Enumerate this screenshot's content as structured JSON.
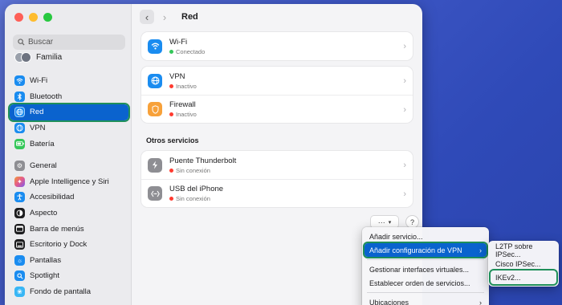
{
  "window": {
    "title": "Red"
  },
  "sidebar": {
    "search_placeholder": "Buscar",
    "family_label": "Familia",
    "items": [
      {
        "label": "Wi-Fi",
        "icon": "wifi-icon",
        "color": "#1a8cf0"
      },
      {
        "label": "Bluetooth",
        "icon": "bluetooth-icon",
        "color": "#1a8cf0"
      },
      {
        "label": "Red",
        "icon": "globe-icon",
        "color": "#1a8cf0",
        "selected": true
      },
      {
        "label": "VPN",
        "icon": "vpn-icon",
        "color": "#1a8cf0"
      },
      {
        "label": "Batería",
        "icon": "battery-icon",
        "color": "#34c759"
      },
      {
        "label": "General",
        "icon": "gear-icon",
        "color": "#8e8e93"
      },
      {
        "label": "Apple Intelligence y Siri",
        "icon": "siri-icon",
        "color": "#e35a8c"
      },
      {
        "label": "Accesibilidad",
        "icon": "accessibility-icon",
        "color": "#1a8cf0"
      },
      {
        "label": "Aspecto",
        "icon": "appearance-icon",
        "color": "#1d1d1f"
      },
      {
        "label": "Barra de menús",
        "icon": "menubar-icon",
        "color": "#1d1d1f"
      },
      {
        "label": "Escritorio y Dock",
        "icon": "dock-icon",
        "color": "#1d1d1f"
      },
      {
        "label": "Pantallas",
        "icon": "display-icon",
        "color": "#1a8cf0"
      },
      {
        "label": "Spotlight",
        "icon": "spotlight-icon",
        "color": "#1a8cf0"
      },
      {
        "label": "Fondo de pantalla",
        "icon": "wallpaper-icon",
        "color": "#38b6f5"
      }
    ]
  },
  "main": {
    "services": [
      {
        "title": "Wi-Fi",
        "status": "Conectado",
        "status_color": "#34c759",
        "icon": "wifi-icon",
        "icon_bg": "#1a8cf0"
      },
      {
        "title": "VPN",
        "status": "Inactivo",
        "status_color": "#ff3b30",
        "icon": "vpn-icon",
        "icon_bg": "#1a8cf0"
      },
      {
        "title": "Firewall",
        "status": "Inactivo",
        "status_color": "#ff3b30",
        "icon": "shield-icon",
        "icon_bg": "#f7a13a"
      }
    ],
    "other_title": "Otros servicios",
    "other_services": [
      {
        "title": "Puente Thunderbolt",
        "status": "Sin conexión",
        "status_color": "#ff3b30",
        "icon": "thunderbolt-icon",
        "icon_bg": "#8e8e93"
      },
      {
        "title": "USB del iPhone",
        "status": "Sin conexión",
        "status_color": "#ff3b30",
        "icon": "usb-icon",
        "icon_bg": "#8e8e93"
      }
    ],
    "action_button": "···",
    "help_button": "?"
  },
  "menu": {
    "items": [
      {
        "label": "Añadir servicio..."
      },
      {
        "label": "Añadir configuración de VPN",
        "active": true,
        "submenu": true
      },
      {
        "label": "Gestionar interfaces virtuales..."
      },
      {
        "label": "Establecer orden de servicios..."
      },
      {
        "label": "Ubicaciones",
        "submenu": true
      }
    ]
  },
  "submenu": {
    "items": [
      {
        "label": "L2TP sobre IPSec..."
      },
      {
        "label": "Cisco IPSec..."
      },
      {
        "label": "IKEv2...",
        "highlighted": true
      }
    ]
  }
}
